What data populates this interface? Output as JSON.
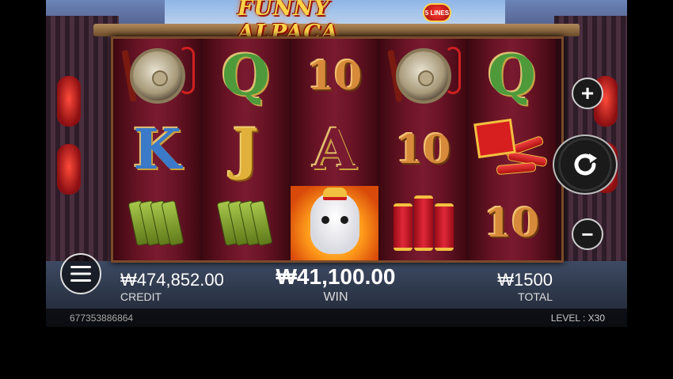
{
  "game": {
    "title": "FUNNY ALPACA",
    "lines_badge": "5 LINES"
  },
  "reels": [
    [
      "gong",
      "K",
      "jade-tablets"
    ],
    [
      "Q",
      "J",
      "jade-tablets"
    ],
    [
      "10",
      "A",
      "alpaca-wild"
    ],
    [
      "gong",
      "10",
      "firecrackers"
    ],
    [
      "Q",
      "firecracker-bundle",
      "10"
    ]
  ],
  "hud": {
    "credit_value": "₩474,852.00",
    "credit_label": "CREDIT",
    "win_value": "₩41,100.00",
    "win_label": "WIN",
    "total_value": "₩1500",
    "total_label": "TOTAL"
  },
  "footer": {
    "session_id": "677353886864",
    "level_text": "LEVEL : X30"
  },
  "controls": {
    "increase_icon": "+",
    "decrease_icon": "−",
    "spin_icon": "spin-arrow-icon",
    "menu_icon": "hamburger-icon"
  },
  "colors": {
    "reel_bg": "#6a1426",
    "title_gold": "#ffd24a"
  }
}
